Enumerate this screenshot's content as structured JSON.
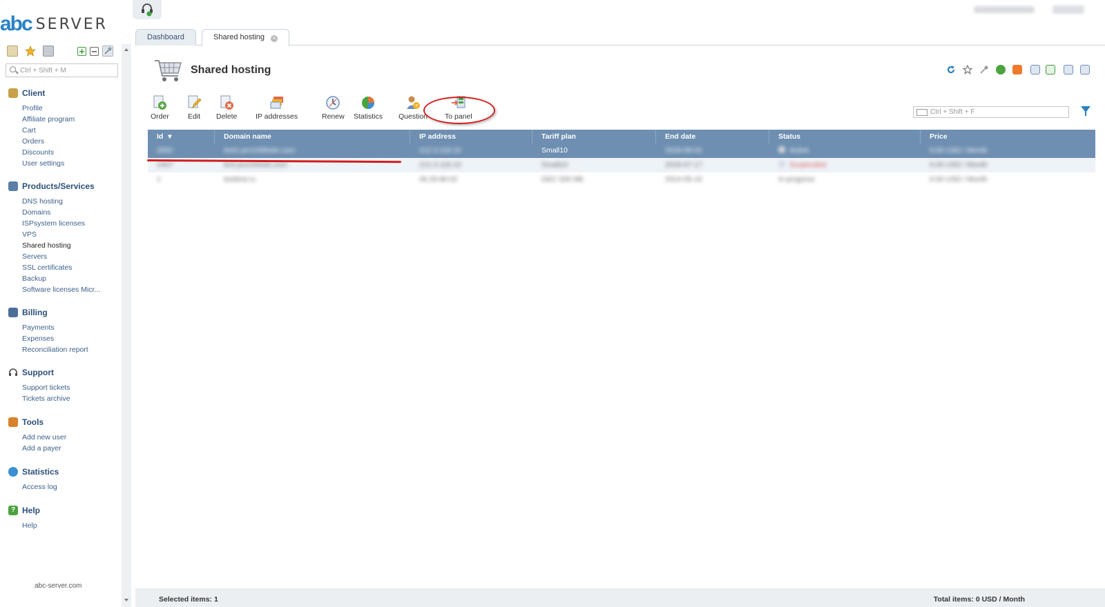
{
  "app": {
    "logo_mark": "abc",
    "logo_word": "SERVER"
  },
  "sidebar": {
    "search_placeholder": "Ctrl + Shift + M",
    "groups": [
      {
        "title": "Client",
        "icon": "client-icon",
        "color": "#c9a14a",
        "items": [
          "Profile",
          "Affiliate program",
          "Cart",
          "Orders",
          "Discounts",
          "User settings"
        ]
      },
      {
        "title": "Products/Services",
        "icon": "cart-icon",
        "color": "#5b7fa5",
        "items": [
          "DNS hosting",
          "Domains",
          "ISPsystem licenses",
          "VPS",
          "Shared hosting",
          "Servers",
          "SSL certificates",
          "Backup",
          "Software licenses Micr..."
        ]
      },
      {
        "title": "Billing",
        "icon": "billing-icon",
        "color": "#4d6f96",
        "items": [
          "Payments",
          "Expenses",
          "Reconciliation report"
        ]
      },
      {
        "title": "Support",
        "icon": "headset-icon",
        "color": "#555555",
        "items": [
          "Support tickets",
          "Tickets archive"
        ]
      },
      {
        "title": "Tools",
        "icon": "tools-icon",
        "color": "#d9822b",
        "items": [
          "Add new user",
          "Add a payer"
        ]
      },
      {
        "title": "Statistics",
        "icon": "globe-icon",
        "color": "#3c8fd1",
        "items": [
          "Access log"
        ]
      },
      {
        "title": "Help",
        "icon": "help-icon",
        "color": "#4aa33f",
        "items": [
          "Help"
        ]
      }
    ],
    "active_item": "Shared hosting",
    "footer": "abc-server.com"
  },
  "tabs": [
    {
      "label": "Dashboard"
    },
    {
      "label": "Shared hosting"
    }
  ],
  "page": {
    "title": "Shared hosting"
  },
  "toolbar": {
    "buttons": [
      {
        "label": "Order",
        "icon": "order-plus-icon",
        "color": "#5aa845"
      },
      {
        "label": "Edit",
        "icon": "edit-pencil-icon",
        "color": "#8aa6c7"
      },
      {
        "label": "Delete",
        "icon": "delete-icon",
        "color": "#d9534f"
      },
      {
        "label": "IP addresses",
        "icon": "ip-addresses-icon",
        "color": "#e2a93b"
      },
      {
        "label": "Renew",
        "icon": "renew-clock-icon",
        "color": "#6c8fbf"
      },
      {
        "label": "Statistics",
        "icon": "pie-chart-icon",
        "color": "#e2733b"
      },
      {
        "label": "Question",
        "icon": "question-user-icon",
        "color": "#c98a4a"
      },
      {
        "label": "To panel",
        "icon": "to-panel-icon",
        "color": "#4f9d4a"
      }
    ]
  },
  "filter": {
    "placeholder": "Ctrl + Shift + F"
  },
  "table": {
    "columns": [
      {
        "label": "Id"
      },
      {
        "label": "Domain name"
      },
      {
        "label": "IP address"
      },
      {
        "label": "Tariff plan"
      },
      {
        "label": "End date"
      },
      {
        "label": "Status"
      },
      {
        "label": "Price"
      }
    ],
    "sort_indicator": "▾",
    "rows": [
      {
        "id": "2832",
        "domain": "test1.pro100bsite.com",
        "ip": "212.3.118.10",
        "tariff": "Small10",
        "end": "2018-08-01",
        "status": "Active",
        "price": "0.00 USD / Month",
        "selected": true
      },
      {
        "id": "2407",
        "domain": "test.pro100site.com",
        "ip": "212.3.118.10",
        "tariff": "Small10",
        "end": "2018-07-17",
        "status": "Suspended",
        "price": "0.00 USD / Month",
        "selected": false
      },
      {
        "id": "1",
        "domain": "testtest.ru",
        "ip": "46.29.80.02",
        "tariff": "GEC 500 Mb",
        "end": "2014-05-15",
        "status": "In progress",
        "price": "0.00 USD / Month",
        "selected": false
      }
    ]
  },
  "footer": {
    "selected": "Selected items: 1",
    "total": "Total items: 0 USD / Month"
  }
}
